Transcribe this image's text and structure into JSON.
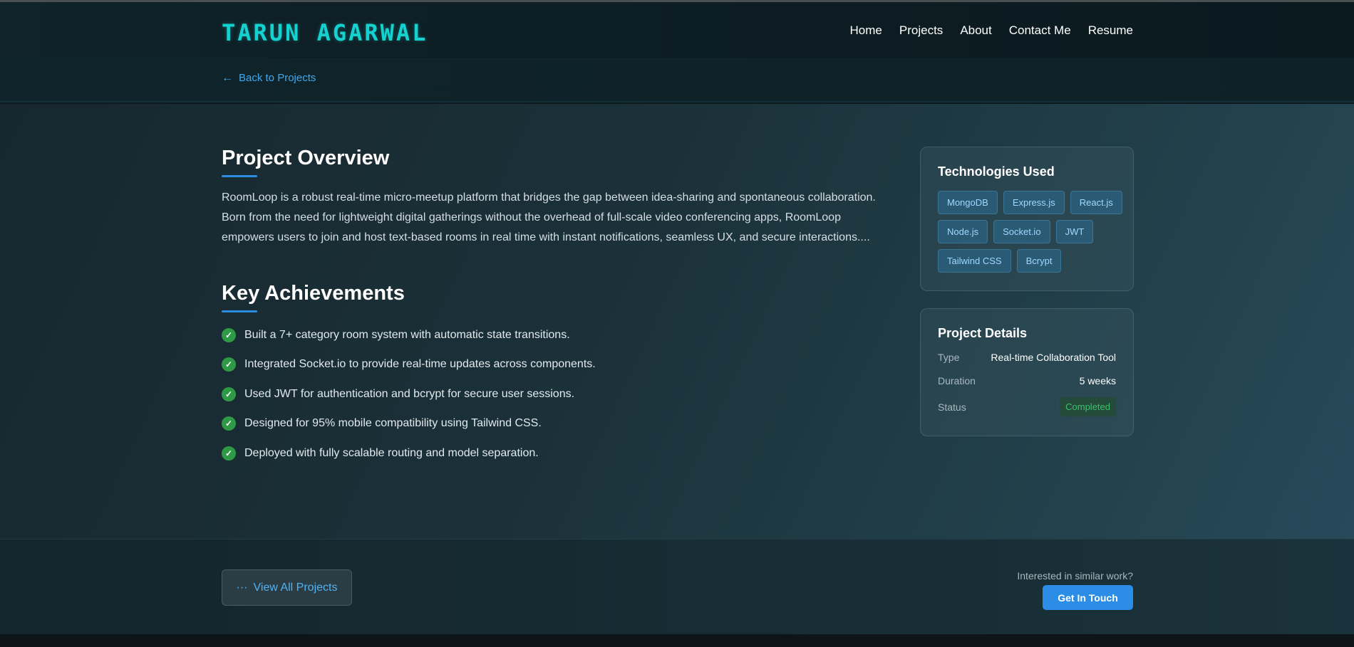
{
  "header": {
    "logo": "TARUN AGARWAL",
    "nav": [
      "Home",
      "Projects",
      "About",
      "Contact Me",
      "Resume"
    ]
  },
  "back": {
    "icon": "arrow-left-icon",
    "label": "Back to Projects"
  },
  "overview": {
    "title": "Project Overview",
    "text": "RoomLoop is a robust real-time micro-meetup platform that bridges the gap between idea-sharing and spontaneous collaboration. Born from the need for lightweight digital gatherings without the overhead of full-scale video conferencing apps, RoomLoop empowers users to join and host text-based rooms in real time with instant notifications, seamless UX, and secure interactions...."
  },
  "achievements": {
    "title": "Key Achievements",
    "icon": "check-circle-icon",
    "items": [
      "Built a 7+ category room system with automatic state transitions.",
      "Integrated Socket.io to provide real-time updates across components.",
      "Used JWT for authentication and bcrypt for secure user sessions.",
      "Designed for 95% mobile compatibility using Tailwind CSS.",
      "Deployed with fully scalable routing and model separation."
    ]
  },
  "technologies": {
    "title": "Technologies Used",
    "tags": [
      "MongoDB",
      "Express.js",
      "React.js",
      "Node.js",
      "Socket.io",
      "JWT",
      "Tailwind CSS",
      "Bcrypt"
    ]
  },
  "details": {
    "title": "Project Details",
    "rows": [
      {
        "label": "Type",
        "value": "Real-time Collaboration Tool"
      },
      {
        "label": "Duration",
        "value": "5 weeks"
      },
      {
        "label": "Status",
        "value": "Completed"
      }
    ]
  },
  "footer": {
    "view_all_icon": "dots-icon",
    "view_all_label": "View All Projects",
    "interest_text": "Interested in similar work?",
    "cta_label": "Get In Touch"
  },
  "colors": {
    "logo": "#14d2d0",
    "accent": "#2b8de6",
    "link": "#3fa8f0",
    "success": "#2e9a46"
  }
}
